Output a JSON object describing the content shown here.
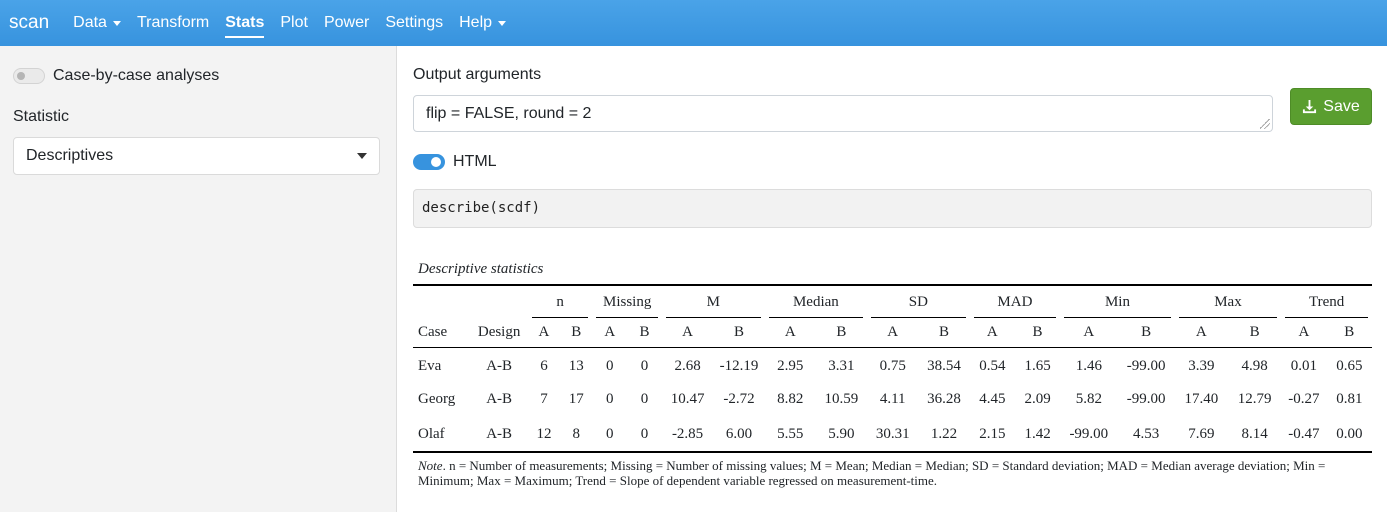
{
  "navbar": {
    "brand": "scan",
    "items": [
      {
        "label": "Data",
        "dropdown": true
      },
      {
        "label": "Transform",
        "dropdown": false
      },
      {
        "label": "Stats",
        "dropdown": false,
        "active": true
      },
      {
        "label": "Plot",
        "dropdown": false
      },
      {
        "label": "Power",
        "dropdown": false
      },
      {
        "label": "Settings",
        "dropdown": false
      },
      {
        "label": "Help",
        "dropdown": true
      }
    ]
  },
  "sidebar": {
    "case_toggle_label": "Case-by-case analyses",
    "case_toggle_on": false,
    "statistic_label": "Statistic",
    "statistic_value": "Descriptives"
  },
  "main": {
    "output_args_label": "Output arguments",
    "output_args_value": "flip = FALSE, round = 2",
    "save_label": "Save",
    "html_toggle_label": "HTML",
    "html_toggle_on": true,
    "code": "describe(scdf)"
  },
  "table": {
    "caption": "Descriptive statistics",
    "groups": [
      "n",
      "Missing",
      "M",
      "Median",
      "SD",
      "MAD",
      "Min",
      "Max",
      "Trend"
    ],
    "case_header": "Case",
    "design_header": "Design",
    "phase_a": "A",
    "phase_b": "B",
    "rows": [
      {
        "case": "Eva",
        "design": "A-B",
        "values": [
          "6",
          "13",
          "0",
          "0",
          "2.68",
          "-12.19",
          "2.95",
          "3.31",
          "0.75",
          "38.54",
          "0.54",
          "1.65",
          "1.46",
          "-99.00",
          "3.39",
          "4.98",
          "0.01",
          "0.65"
        ]
      },
      {
        "case": "Georg",
        "design": "A-B",
        "values": [
          "7",
          "17",
          "0",
          "0",
          "10.47",
          "-2.72",
          "8.82",
          "10.59",
          "4.11",
          "36.28",
          "4.45",
          "2.09",
          "5.82",
          "-99.00",
          "17.40",
          "12.79",
          "-0.27",
          "0.81"
        ]
      },
      {
        "case": "Olaf",
        "design": "A-B",
        "values": [
          "12",
          "8",
          "0",
          "0",
          "-2.85",
          "6.00",
          "5.55",
          "5.90",
          "30.31",
          "1.22",
          "2.15",
          "1.42",
          "-99.00",
          "4.53",
          "7.69",
          "8.14",
          "-0.47",
          "0.00"
        ]
      }
    ],
    "note_label": "Note",
    "note_text": ". n = Number of measurements; Missing = Number of missing values; M = Mean; Median = Median; SD = Standard deviation; MAD = Median average deviation; Min = Minimum; Max = Maximum; Trend = Slope of dependent variable regressed on measurement-time."
  },
  "colors": {
    "navbar": "#3793de",
    "save_button": "#5a9e2f",
    "toggle_on": "#3793de"
  }
}
